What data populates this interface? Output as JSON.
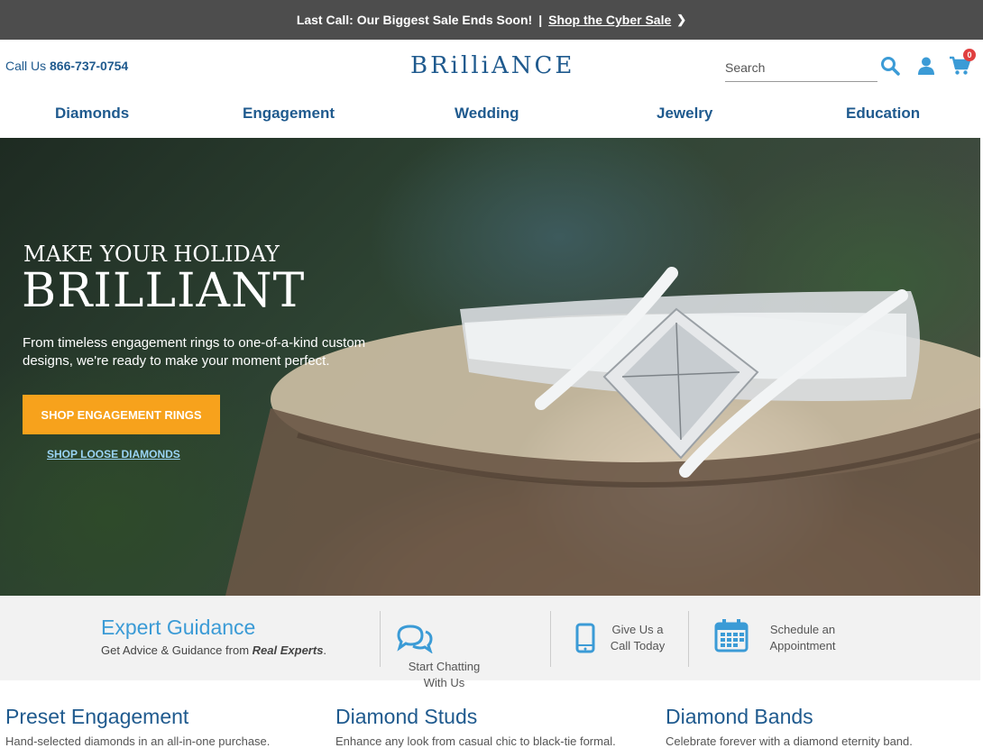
{
  "promo": {
    "text": "Last Call: Our Biggest Sale Ends Soon!",
    "separator": "|",
    "link": "Shop the Cyber Sale"
  },
  "header": {
    "call_label": "Call Us",
    "phone": "866-737-0754",
    "logo": "BRilliANCE",
    "search_placeholder": "Search",
    "cart_count": "0"
  },
  "nav": [
    "Diamonds",
    "Engagement",
    "Wedding",
    "Jewelry",
    "Education"
  ],
  "hero": {
    "subtitle": "MAKE YOUR HOLIDAY",
    "title": "BRILLIANT",
    "description": "From timeless engagement rings to one-of-a-kind custom designs, we're ready to make your moment perfect.",
    "cta_primary": "SHOP ENGAGEMENT RINGS",
    "cta_secondary": "SHOP LOOSE DIAMONDS"
  },
  "guidance": {
    "title": "Expert Guidance",
    "subtitle_prefix": "Get Advice & Guidance from",
    "subtitle_emphasis": "Real Experts",
    "subtitle_suffix": ".",
    "chat_line1": "Start Chatting",
    "chat_line2": "With Us",
    "call_line1": "Give Us a",
    "call_line2": "Call Today",
    "appt_line1": "Schedule an",
    "appt_line2": "Appointment"
  },
  "categories": [
    {
      "title": "Preset Engagement",
      "desc": "Hand-selected diamonds in an all-in-one purchase."
    },
    {
      "title": "Diamond Studs",
      "desc": "Enhance any look from casual chic to black-tie formal."
    },
    {
      "title": "Diamond Bands",
      "desc": "Celebrate forever with a diamond eternity band."
    }
  ],
  "colors": {
    "brand_blue": "#1f5a8e",
    "accent_blue": "#3b9bd6",
    "cta_orange": "#f7a21c",
    "promo_bg": "#4d4d4d"
  }
}
